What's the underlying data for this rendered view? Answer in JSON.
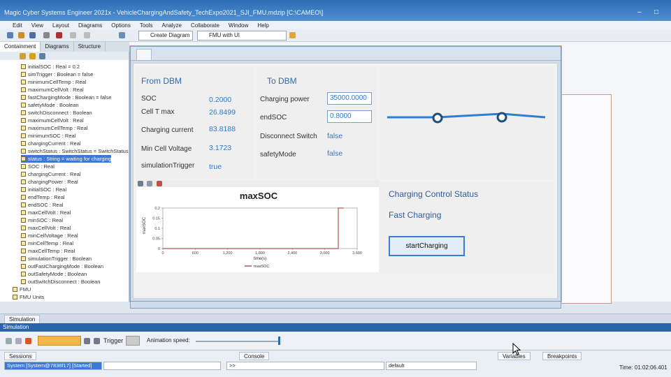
{
  "app": {
    "title": "Magic Cyber Systems Engineer 2021x - VehicleChargingAndSafety_TechExpo2021_SJI_FMU.mdzip [C:\\CAMEO\\]"
  },
  "menu": [
    "Edit",
    "View",
    "Layout",
    "Diagrams",
    "Options",
    "Tools",
    "Analyze",
    "Collaborate",
    "Window",
    "Help"
  ],
  "toolbar": {
    "create_diagram": "Create Diagram",
    "perspective": "FMU with UI"
  },
  "left_tabs": [
    "Containment",
    "Diagrams",
    "Structure"
  ],
  "tree": [
    "initialSOC : Real = 0.2",
    "simTrigger : Boolean = false",
    "minimumCellTemp : Real",
    "maximumCellVolt : Real",
    "fastChargingMode : Boolean = false",
    "safetyMode : Boolean",
    "switchDisconnect : Boolean",
    "maximumCellVolt : Real",
    "maximumCellTemp : Real",
    "minimumSOC : Real",
    "chargingCurrent : Real",
    "switchStatus : SwitchStatus = SwitchStatus",
    "status : String = waiting for charging",
    "SOC : Real",
    "chargingCurrent : Real",
    "chargingPower : Real",
    "initialSOC : Real",
    "endTemp : Real",
    "endSOC : Real",
    "maxCellVolt : Real",
    "minSOC : Real",
    "maxCellVolt : Real",
    "minCellVoltage : Real",
    "minCellTemp : Real",
    "maxCellTemp : Real",
    "simulationTrigger : Boolean",
    "outFastChargingMode : Boolean",
    "outSafetyMode : Boolean",
    "outSwitchDisconnect : Boolean",
    "FMU",
    "FMU Units"
  ],
  "from_dbm": {
    "heading": "From DBM",
    "rows": [
      {
        "label": "SOC",
        "value": "0.2000"
      },
      {
        "label": "Cell T max",
        "value": "26.8499"
      },
      {
        "label": "Charging current",
        "value": "83.8188"
      },
      {
        "label": "Min Cell Voltage",
        "value": "3.1723"
      },
      {
        "label": "simulationTrigger",
        "value": "true"
      }
    ]
  },
  "to_dbm": {
    "heading": "To DBM",
    "charging_power_label": "Charging power",
    "charging_power_value": "35000.0000",
    "end_soc_label": "endSOC",
    "end_soc_value": "0.8000",
    "disconnect_label": "Disconnect Switch",
    "disconnect_value": "false",
    "safety_label": "safetyMode",
    "safety_value": "false"
  },
  "switch_diagram": {
    "color": "#2a7fd4",
    "knob_color": "#1f4e7a"
  },
  "chart_data": {
    "type": "line",
    "title": "maxSOC",
    "xlabel": "time(s)",
    "ylabel": "maxSOC",
    "x_ticks": [
      "0",
      "600",
      "1,200",
      "1,800",
      "2,400",
      "3,000",
      "3,600"
    ],
    "y_ticks": [
      "0",
      "0.05",
      "0.1",
      "0.15",
      "0.2"
    ],
    "xlim": [
      0,
      3600
    ],
    "ylim": [
      0,
      0.2
    ],
    "legend": "bottom",
    "series": [
      {
        "name": "maxSOC",
        "color": "#c0504d",
        "x": [
          0,
          3250,
          3250,
          3350
        ],
        "y": [
          0,
          0,
          0.2,
          0.2
        ]
      }
    ]
  },
  "status_panel": {
    "heading": "Charging Control Status",
    "status": "Fast Charging",
    "button": "startCharging"
  },
  "bottom": {
    "sim_tab": "Simulation",
    "sim_bar": "Simulation",
    "trigger_label": "Trigger",
    "animation_label": "Animation speed:",
    "sessions_tab": "Sessions",
    "session_value": "System [System@7838f17] [Started]",
    "console_tab": "Console",
    "console_prompt": ">>",
    "console_context": "default",
    "variables_tab": "Variables",
    "breakpoints_tab": "Breakpoints",
    "time_readout": "Time: 01:02:06.401"
  }
}
